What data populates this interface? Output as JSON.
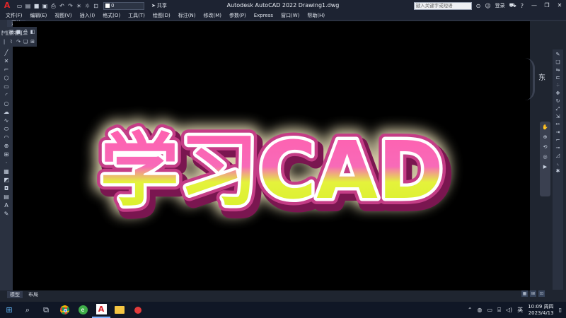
{
  "window": {
    "title": "Autodesk AutoCAD 2022   Drawing1.dwg",
    "search_placeholder": "键入关键字或短语",
    "login": "登录",
    "layer_value": "0",
    "share_label": "共享"
  },
  "menu": [
    "文件(F)",
    "编辑(E)",
    "视图(V)",
    "插入(I)",
    "格式(O)",
    "工具(T)",
    "绘图(D)",
    "标注(N)",
    "修改(M)",
    "参数(P)",
    "Express",
    "窗口(W)",
    "帮助(H)"
  ],
  "doc_tab": "开始",
  "viewport_label": "[-][俯视][二",
  "viewcube": {
    "direction": "东"
  },
  "layout_tabs": [
    "模型",
    "布局"
  ],
  "artwork": {
    "text": "学习CAD"
  },
  "taskbar": {
    "time": "10:09 周四",
    "date": "2023/4/13",
    "ime": "英"
  }
}
